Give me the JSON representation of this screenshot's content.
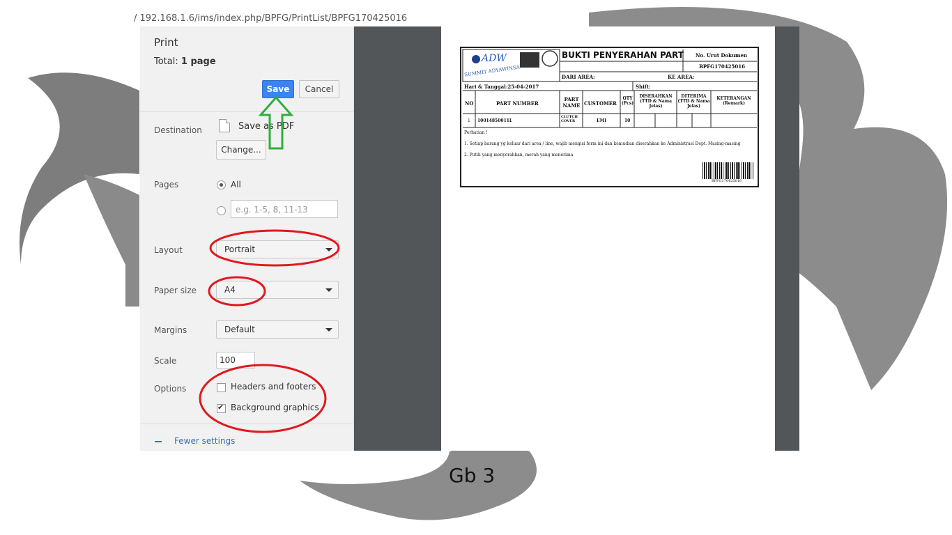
{
  "url_partial": "/ 192.168.1.6/ims/index.php/BPFG/PrintList/BPFG170425016",
  "dialog": {
    "title": "Print",
    "total_label": "Total:",
    "total_value": "1 page",
    "save_label": "Save",
    "cancel_label": "Cancel",
    "destination": {
      "label": "Destination",
      "value": "Save as PDF",
      "change_label": "Change..."
    },
    "pages": {
      "label": "Pages",
      "all_label": "All",
      "custom_placeholder": "e.g. 1-5, 8, 11-13",
      "selected": "All"
    },
    "layout": {
      "label": "Layout",
      "value": "Portrait"
    },
    "paper_size": {
      "label": "Paper size",
      "value": "A4"
    },
    "margins": {
      "label": "Margins",
      "value": "Default"
    },
    "scale": {
      "label": "Scale",
      "value": "100"
    },
    "options": {
      "label": "Options",
      "headers_footers": {
        "label": "Headers and footers",
        "checked": false
      },
      "background_graphics": {
        "label": "Background graphics",
        "checked": true
      }
    },
    "fewer_settings_label": "Fewer settings"
  },
  "preview_document": {
    "company": "ADW",
    "company_sub": "SUMMIT ADYAWINSA",
    "title": "BUKTI PENYERAHAN PART",
    "doc_no_label": "No. Urut Dokumen",
    "doc_no_value": "BPFG170425016",
    "dari_area": "DARI AREA:",
    "ke_area": "KE AREA:",
    "hari_tanggal": "Hari & Tanggal:25-04-2017",
    "shift": "Shift:",
    "headers": [
      "NO",
      "PART NUMBER",
      "PART NAME",
      "CUSTOMER",
      "QTY (Pcs)",
      "DISERAHKAN (TTD & Nama Jelas)",
      "DITERIMA (TTD & Nama Jelas)",
      "KETERANGAN (Remark)"
    ],
    "rows": [
      {
        "no": "1",
        "part_number": "10014850011L",
        "part_name": "CLUTCH COVER",
        "customer": "EMI",
        "qty": "10"
      }
    ],
    "perhatian": "Perhatian !",
    "note1": "1. Setiap barang yg keluar dari area / line, wajib mengisi form ini dan kemudian diserahkan ke Administrasi Dept. Masing-masing",
    "note2": "2. Putih yang menyerahkan, merah yang menerima",
    "barcode_text": "BPFG170425016"
  },
  "caption": "Gb 3",
  "colors": {
    "save_button": "#3c84f2",
    "annotation_red": "#e0191e",
    "annotation_green": "#2fae3c",
    "preview_bg": "#525659"
  }
}
